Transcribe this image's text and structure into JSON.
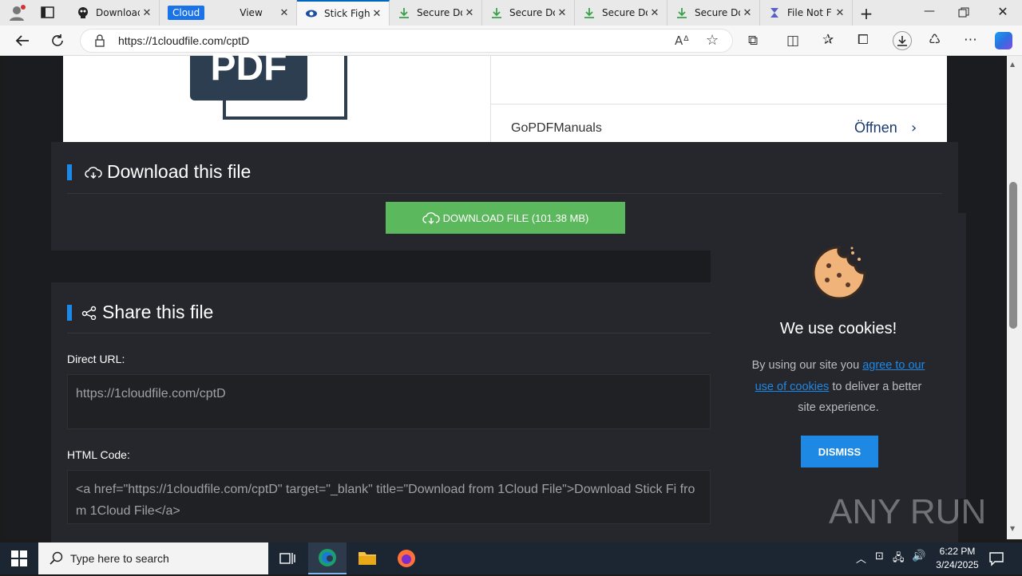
{
  "browser": {
    "tabs": [
      {
        "title": "Download",
        "icon": "skull-icon"
      },
      {
        "title": "Cloud",
        "icon": "cloud-pill"
      },
      {
        "title": "View",
        "icon": ""
      },
      {
        "title": "Stick Figh",
        "icon": "eye-icon"
      },
      {
        "title": "Secure Do",
        "icon": "download-icon"
      },
      {
        "title": "Secure Do",
        "icon": "download-icon"
      },
      {
        "title": "Secure Do",
        "icon": "download-icon"
      },
      {
        "title": "Secure Do",
        "icon": "download-icon"
      },
      {
        "title": "File Not F",
        "icon": "page-icon"
      }
    ],
    "url": "https://1cloudfile.com/cptD"
  },
  "ad": {
    "logo_text": "PDF",
    "name": "GoPDFManuals",
    "open_label": "Öffnen"
  },
  "download": {
    "title": "Download this file",
    "button_label": "DOWNLOAD FILE (101.38 MB)"
  },
  "share": {
    "title": "Share this file",
    "direct_label": "Direct URL:",
    "direct_value": "https://1cloudfile.com/cptD",
    "html_label": "HTML Code:",
    "html_value": "<a href=\"https://1cloudfile.com/cptD\" target=\"_blank\" title=\"Download from 1Cloud File\">Download Stick Fi from 1Cloud File</a>"
  },
  "cookie": {
    "title": "We use cookies!",
    "text_before": "By using our site you ",
    "link": "agree to our use of cookies",
    "text_after": " to deliver a better site experience.",
    "button": "DISMISS"
  },
  "watermark": "ANY RUN",
  "taskbar": {
    "search_placeholder": "Type here to search",
    "time": "6:22 PM",
    "date": "3/24/2025"
  },
  "colors": {
    "accent": "#1e88e5",
    "download_button": "#5cb85c",
    "dismiss_button": "#1e88e5"
  }
}
